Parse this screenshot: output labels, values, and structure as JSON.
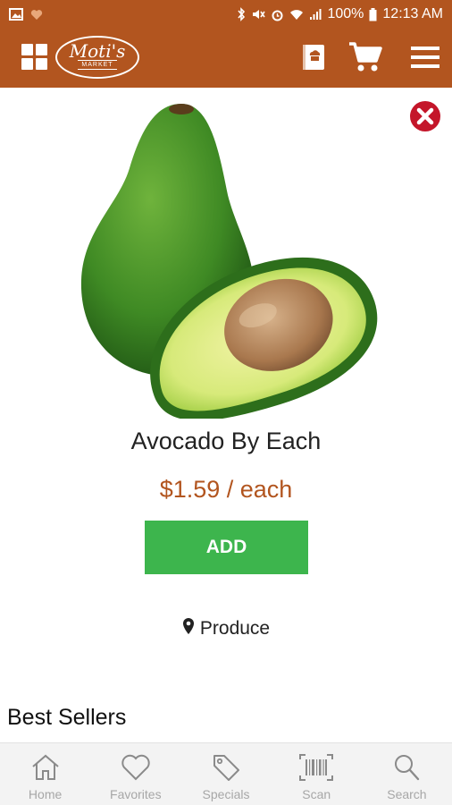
{
  "status_bar": {
    "battery": "100%",
    "time": "12:13 AM"
  },
  "app_bar": {
    "logo_name": "Moti's",
    "logo_sub": "MARKET"
  },
  "product": {
    "name": "Avocado By Each",
    "price": "$1.59 / each",
    "add_label": "ADD",
    "category": "Produce"
  },
  "section": {
    "title": "Best Sellers"
  },
  "bottom_nav": {
    "items": [
      {
        "label": "Home",
        "icon": "home-icon"
      },
      {
        "label": "Favorites",
        "icon": "heart-icon"
      },
      {
        "label": "Specials",
        "icon": "tag-icon"
      },
      {
        "label": "Scan",
        "icon": "barcode-icon"
      },
      {
        "label": "Search",
        "icon": "search-icon"
      }
    ]
  },
  "colors": {
    "brand": "#b2551f",
    "accent_green": "#3db54d",
    "close_red": "#c4162a"
  }
}
